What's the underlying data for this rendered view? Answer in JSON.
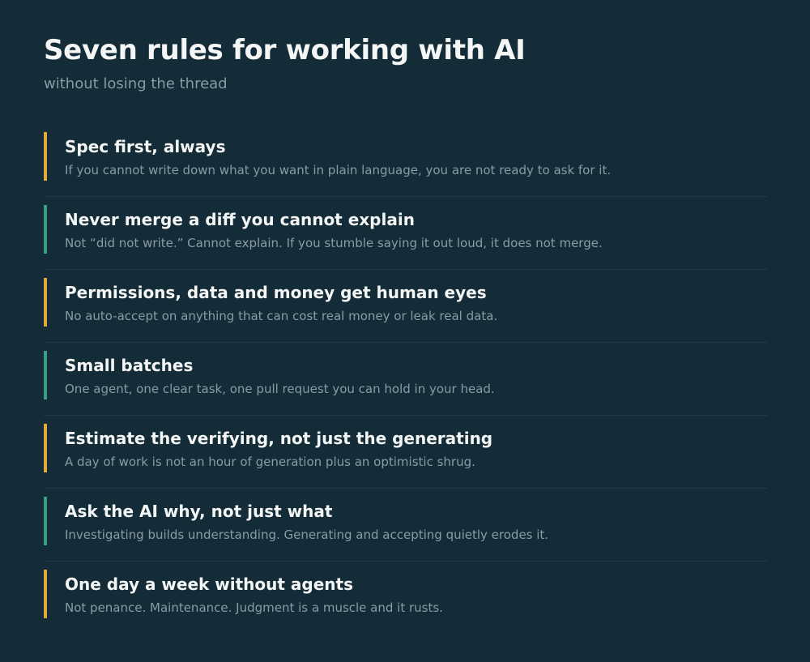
{
  "header": {
    "title": "Seven rules for working with AI",
    "subtitle": "without losing the thread"
  },
  "colors": {
    "background": "#132c38",
    "accent_amber": "#e0a93a",
    "accent_teal": "#3a9f87",
    "divider": "#1f3c49",
    "muted_text": "#8a9ba3"
  },
  "rules": [
    {
      "title": "Spec first, always",
      "description": "If you cannot write down what you want in plain language, you are not ready to ask for it.",
      "accent": "#e0a93a"
    },
    {
      "title": "Never merge a diff you cannot explain",
      "description": "Not “did not write.” Cannot explain. If you stumble saying it out loud, it does not merge.",
      "accent": "#3a9f87"
    },
    {
      "title": "Permissions, data and money get human eyes",
      "description": "No auto-accept on anything that can cost real money or leak real data.",
      "accent": "#e0a93a"
    },
    {
      "title": "Small batches",
      "description": "One agent, one clear task, one pull request you can hold in your head.",
      "accent": "#3a9f87"
    },
    {
      "title": "Estimate the verifying, not just the generating",
      "description": "A day of work is not an hour of generation plus an optimistic shrug.",
      "accent": "#e0a93a"
    },
    {
      "title": "Ask the AI why, not just what",
      "description": "Investigating builds understanding. Generating and accepting quietly erodes it.",
      "accent": "#3a9f87"
    },
    {
      "title": "One day a week without agents",
      "description": "Not penance. Maintenance. Judgment is a muscle and it rusts.",
      "accent": "#e0a93a"
    }
  ]
}
